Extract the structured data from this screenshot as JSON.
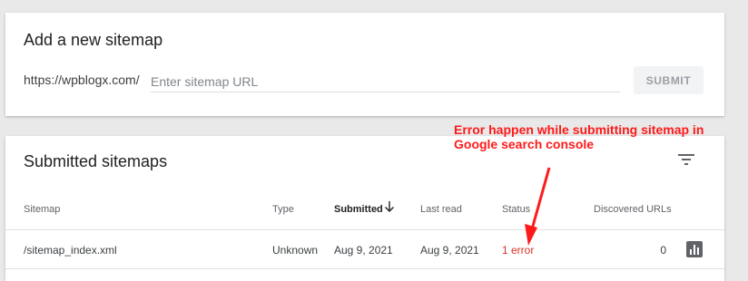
{
  "add_sitemap": {
    "title": "Add a new sitemap",
    "url_prefix": "https://wpblogx.com/",
    "input_placeholder": "Enter sitemap URL",
    "submit_label": "SUBMIT"
  },
  "submitted": {
    "title": "Submitted sitemaps",
    "columns": {
      "sitemap": "Sitemap",
      "type": "Type",
      "submitted": "Submitted",
      "last_read": "Last read",
      "status": "Status",
      "discovered": "Discovered URLs"
    },
    "rows": [
      {
        "sitemap": "/sitemap_index.xml",
        "type": "Unknown",
        "submitted": "Aug 9, 2021",
        "last_read": "Aug 9, 2021",
        "status": "1 error",
        "discovered": "0"
      }
    ],
    "sort_column": "Submitted",
    "icons": {
      "filter": "filter-icon",
      "sort": "arrow-down-icon",
      "chart": "bar-chart-icon"
    }
  },
  "annotation": {
    "line1": "Error happen while submitting sitemap in",
    "line2": "Google search console",
    "color": "#ff1a1a"
  },
  "colors": {
    "background": "#e9e9e9",
    "error": "#d93025"
  }
}
